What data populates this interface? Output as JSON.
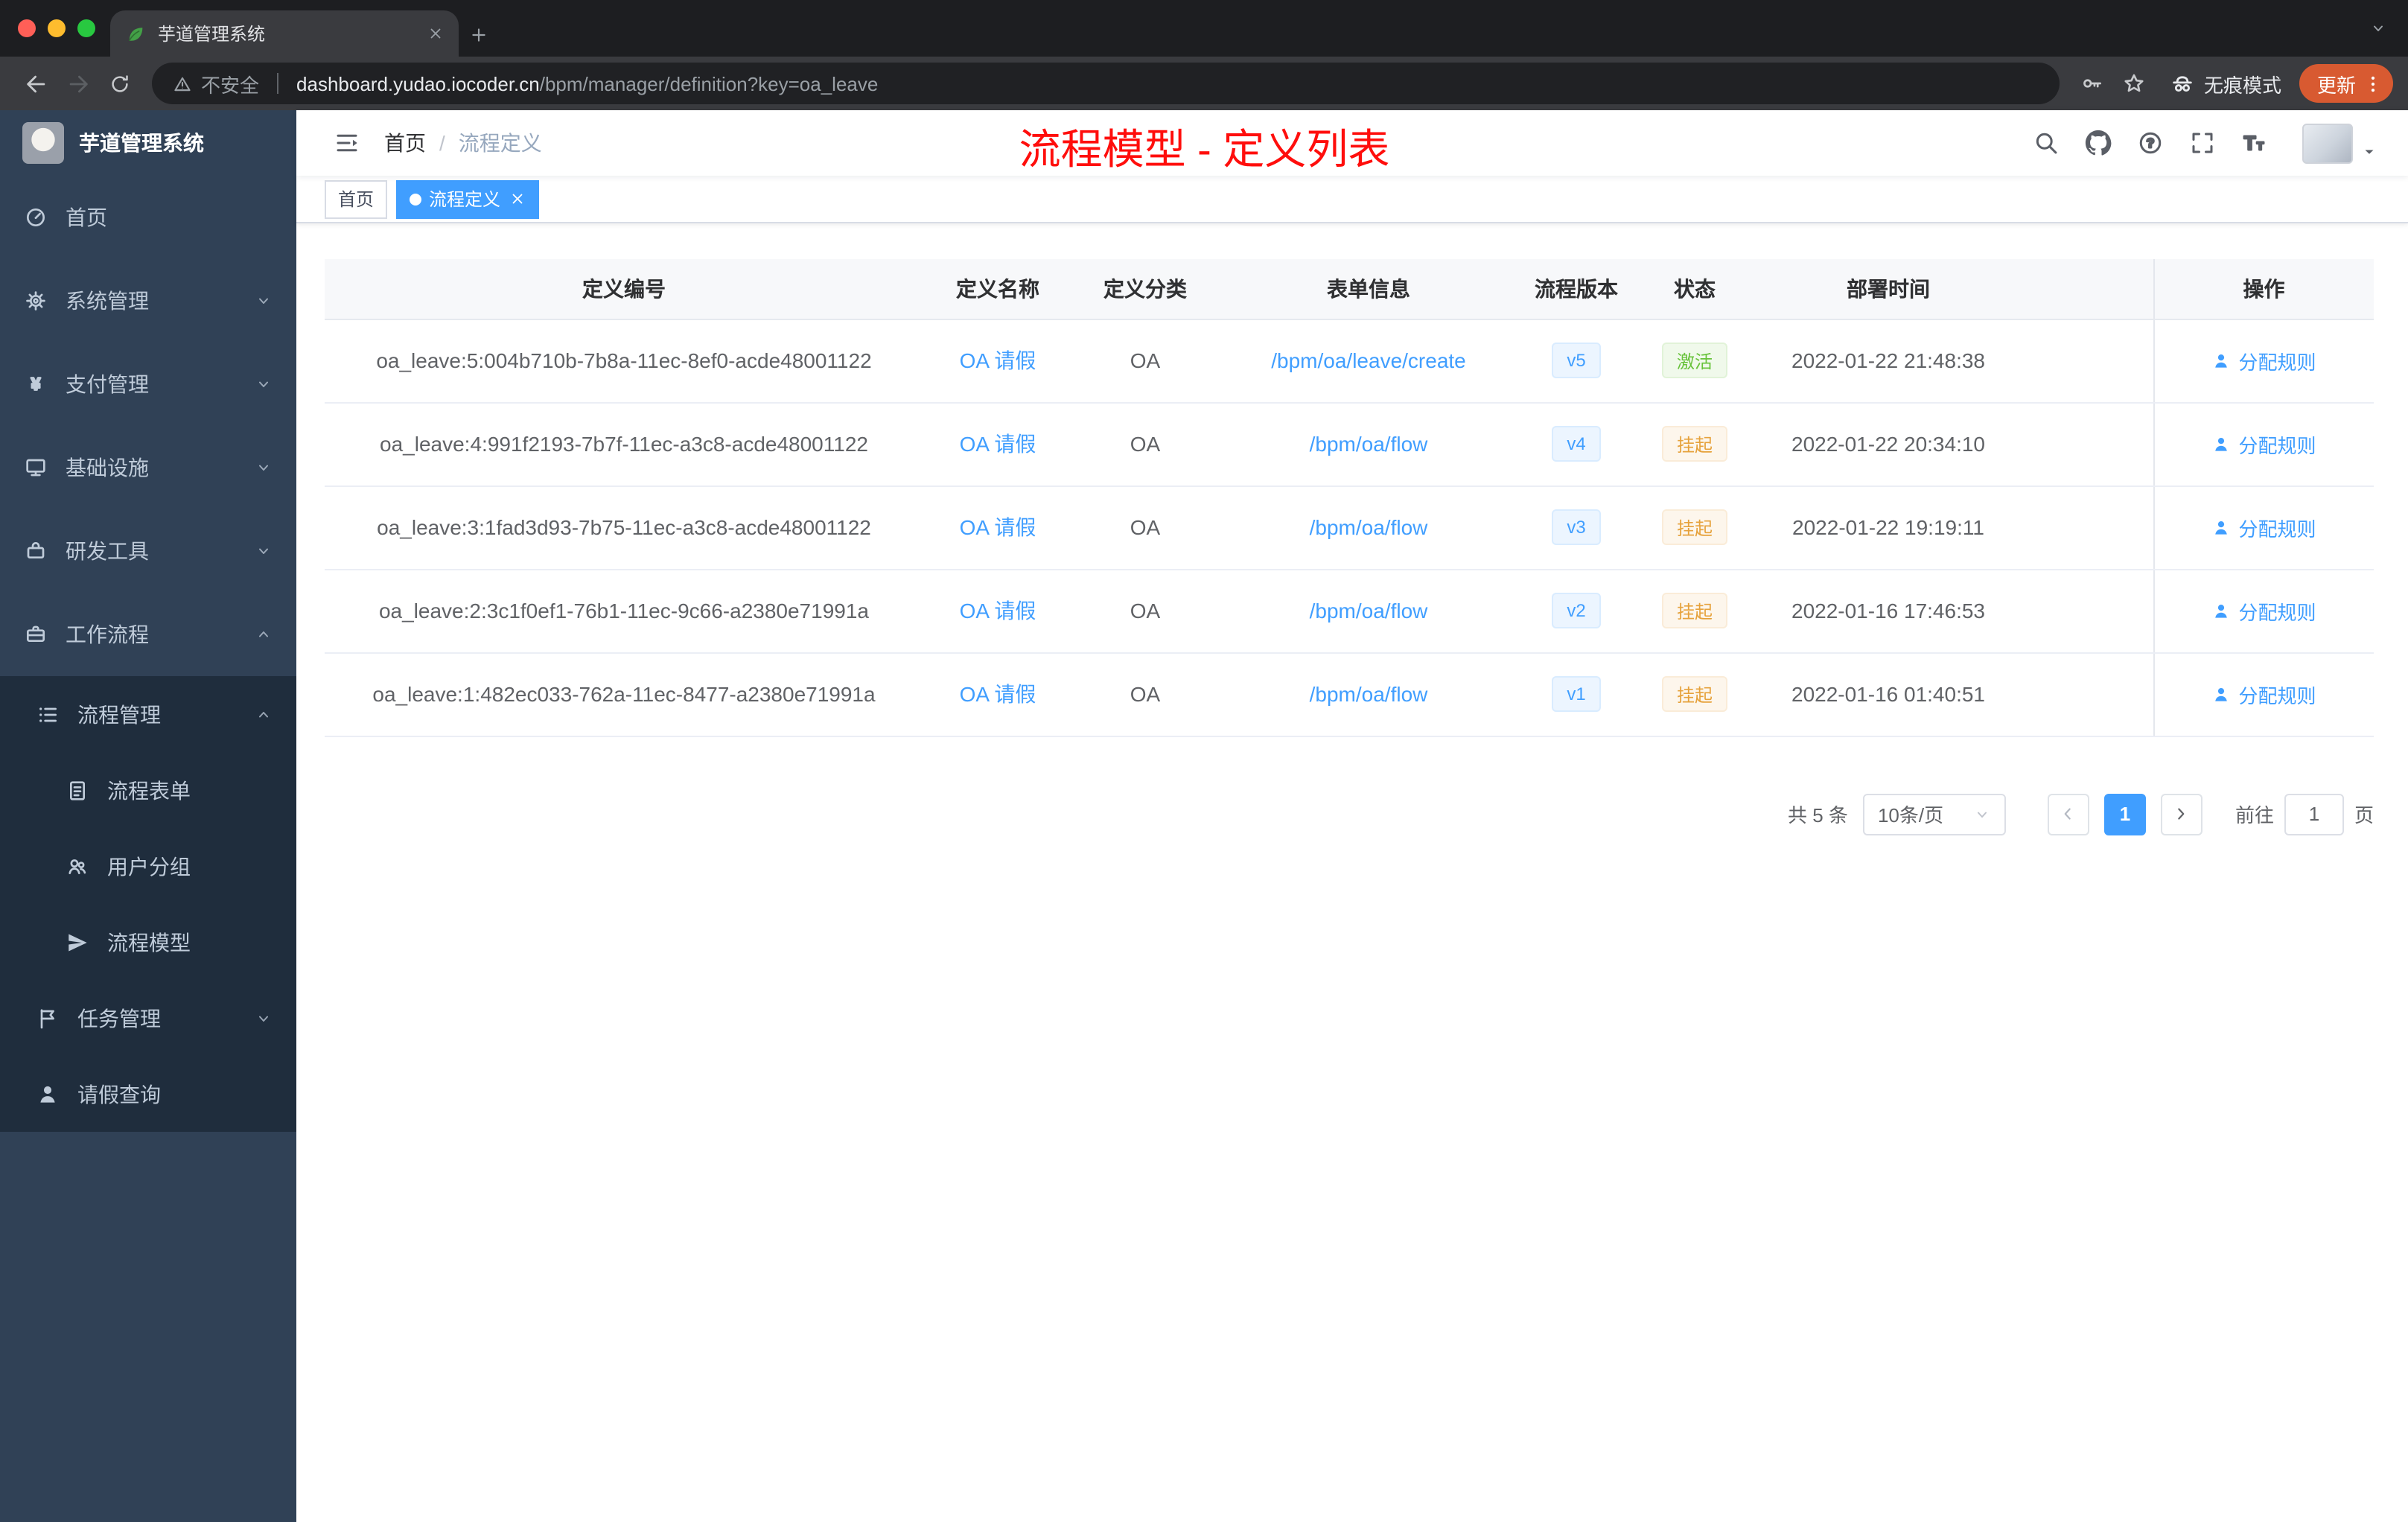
{
  "colors": {
    "accent": "#409eff",
    "success": "#67c23a",
    "warning": "#e6a23c",
    "annotation": "#ff0e0c",
    "sidebar_bg": "#304156",
    "submenu_bg": "#1f2d3d",
    "update_pill": "#d85a31"
  },
  "browser": {
    "tab_title": "芋道管理系统",
    "security_label": "不安全",
    "url_host": "dashboard.yudao.iocoder.cn",
    "url_path": "/bpm/manager/definition?key=oa_leave",
    "incognito_label": "无痕模式",
    "update_label": "更新"
  },
  "sidebar": {
    "logo_title": "芋道管理系统",
    "menu": [
      {
        "label": "首页"
      },
      {
        "label": "系统管理"
      },
      {
        "label": "支付管理"
      },
      {
        "label": "基础设施"
      },
      {
        "label": "研发工具"
      },
      {
        "label": "工作流程"
      },
      {
        "label": "流程管理"
      },
      {
        "label": "流程表单"
      },
      {
        "label": "用户分组"
      },
      {
        "label": "流程模型"
      },
      {
        "label": "任务管理"
      },
      {
        "label": "请假查询"
      }
    ]
  },
  "header": {
    "breadcrumb_home": "首页",
    "breadcrumb_sep": "/",
    "breadcrumb_current": "流程定义",
    "annotation": "流程模型 - 定义列表"
  },
  "tags": {
    "home": "首页",
    "current": "流程定义"
  },
  "table": {
    "columns": [
      "定义编号",
      "定义名称",
      "定义分类",
      "表单信息",
      "流程版本",
      "状态",
      "部署时间",
      "操作"
    ],
    "rows": [
      {
        "id": "oa_leave:5:004b710b-7b8a-11ec-8ef0-acde48001122",
        "name": "OA 请假",
        "category": "OA",
        "form": "/bpm/oa/leave/create",
        "version": "v5",
        "status": "激活",
        "time": "2022-01-22 21:48:38",
        "action": "分配规则"
      },
      {
        "id": "oa_leave:4:991f2193-7b7f-11ec-a3c8-acde48001122",
        "name": "OA 请假",
        "category": "OA",
        "form": "/bpm/oa/flow",
        "version": "v4",
        "status": "挂起",
        "time": "2022-01-22 20:34:10",
        "action": "分配规则"
      },
      {
        "id": "oa_leave:3:1fad3d93-7b75-11ec-a3c8-acde48001122",
        "name": "OA 请假",
        "category": "OA",
        "form": "/bpm/oa/flow",
        "version": "v3",
        "status": "挂起",
        "time": "2022-01-22 19:19:11",
        "action": "分配规则"
      },
      {
        "id": "oa_leave:2:3c1f0ef1-76b1-11ec-9c66-a2380e71991a",
        "name": "OA 请假",
        "category": "OA",
        "form": "/bpm/oa/flow",
        "version": "v2",
        "status": "挂起",
        "time": "2022-01-16 17:46:53",
        "action": "分配规则"
      },
      {
        "id": "oa_leave:1:482ec033-762a-11ec-8477-a2380e71991a",
        "name": "OA 请假",
        "category": "OA",
        "form": "/bpm/oa/flow",
        "version": "v1",
        "status": "挂起",
        "time": "2022-01-16 01:40:51",
        "action": "分配规则"
      }
    ]
  },
  "pagination": {
    "total": "共 5 条",
    "page_size": "10条/页",
    "current_page": "1",
    "goto_label": "前往",
    "goto_value": "1",
    "unit_label": "页"
  }
}
